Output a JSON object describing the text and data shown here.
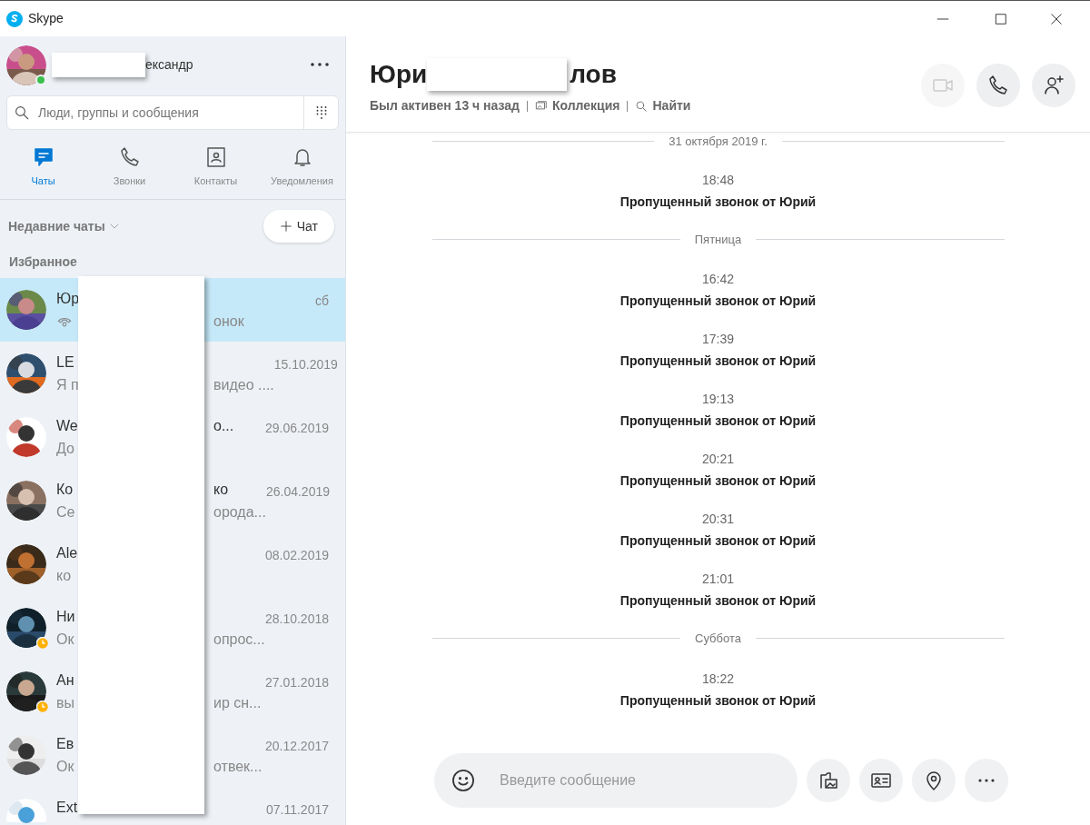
{
  "window": {
    "title": "Skype"
  },
  "profile": {
    "name_visible": "ександр",
    "online": true
  },
  "search": {
    "placeholder": "Люди, группы и сообщения"
  },
  "tabs": [
    {
      "kind": "chats",
      "label": "Чаты",
      "selected": true
    },
    {
      "kind": "calls",
      "label": "Звонки",
      "selected": false
    },
    {
      "kind": "contacts",
      "label": "Контакты",
      "selected": false
    },
    {
      "kind": "notifications",
      "label": "Уведомления",
      "selected": false
    }
  ],
  "recent_label": "Недавние чаты",
  "new_chat_button": "Чат",
  "section_label": "Избранное",
  "chats": [
    {
      "name_left": "Юр",
      "preview_right": "онок",
      "call_icon": true,
      "date": "сб",
      "selected": true,
      "away": false
    },
    {
      "name_left": "LE",
      "preview_left": "Я п",
      "preview_right": "видео ....",
      "call_icon": false,
      "date": "15.10.2019",
      "selected": false,
      "away": false
    },
    {
      "name_left": "We",
      "name_right": "o...",
      "preview_left": "До",
      "call_icon": false,
      "date": "29.06.2019",
      "selected": false,
      "away": false
    },
    {
      "name_left": "Ко",
      "name_right": "ко",
      "preview_left": "Се",
      "preview_right": "орода...",
      "call_icon": false,
      "date": "26.04.2019",
      "selected": false,
      "away": false
    },
    {
      "name_left": "Ale",
      "preview_left": "ко",
      "call_icon": false,
      "date": "08.02.2019",
      "selected": false,
      "away": false
    },
    {
      "name_left": "Ни",
      "preview_left": "Ок",
      "preview_right": "опрос...",
      "call_icon": false,
      "date": "28.10.2018",
      "selected": false,
      "away": true
    },
    {
      "name_left": "Ан",
      "preview_left": "вы",
      "preview_right": "ир сн...",
      "call_icon": false,
      "date": "27.01.2018",
      "selected": false,
      "away": true
    },
    {
      "name_left": "Ев",
      "preview_left": "Ок",
      "preview_right": "отвек...",
      "call_icon": false,
      "date": "20.12.2017",
      "selected": false,
      "away": false
    },
    {
      "name_left": "Ext",
      "call_icon": false,
      "date": "07.11.2017",
      "selected": false,
      "away": false
    }
  ],
  "conversation": {
    "title_left": "Юри",
    "title_right": "лов",
    "status": "Был активен 13 ч назад",
    "gallery_link": "Коллекция",
    "find_link": "Найти",
    "actions": [
      {
        "kind": "video",
        "disabled": true
      },
      {
        "kind": "call",
        "disabled": false
      },
      {
        "kind": "add_person",
        "disabled": false
      }
    ]
  },
  "messages": [
    {
      "kind": "divider",
      "text": "31 октября 2019 г."
    },
    {
      "kind": "call",
      "time": "18:48",
      "text": "Пропущенный звонок от Юрий"
    },
    {
      "kind": "divider",
      "text": "Пятница"
    },
    {
      "kind": "call",
      "time": "16:42",
      "text": "Пропущенный звонок от Юрий"
    },
    {
      "kind": "call",
      "time": "17:39",
      "text": "Пропущенный звонок от Юрий"
    },
    {
      "kind": "call",
      "time": "19:13",
      "text": "Пропущенный звонок от Юрий"
    },
    {
      "kind": "call",
      "time": "20:21",
      "text": "Пропущенный звонок от Юрий"
    },
    {
      "kind": "call",
      "time": "20:31",
      "text": "Пропущенный звонок от Юрий"
    },
    {
      "kind": "call",
      "time": "21:01",
      "text": "Пропущенный звонок от Юрий"
    },
    {
      "kind": "divider",
      "text": "Суббота"
    },
    {
      "kind": "call",
      "time": "18:22",
      "text": "Пропущенный звонок от Юрий"
    }
  ],
  "composer": {
    "placeholder": "Введите сообщение",
    "tools": [
      {
        "kind": "media"
      },
      {
        "kind": "contact_card"
      },
      {
        "kind": "location"
      },
      {
        "kind": "more"
      }
    ]
  }
}
